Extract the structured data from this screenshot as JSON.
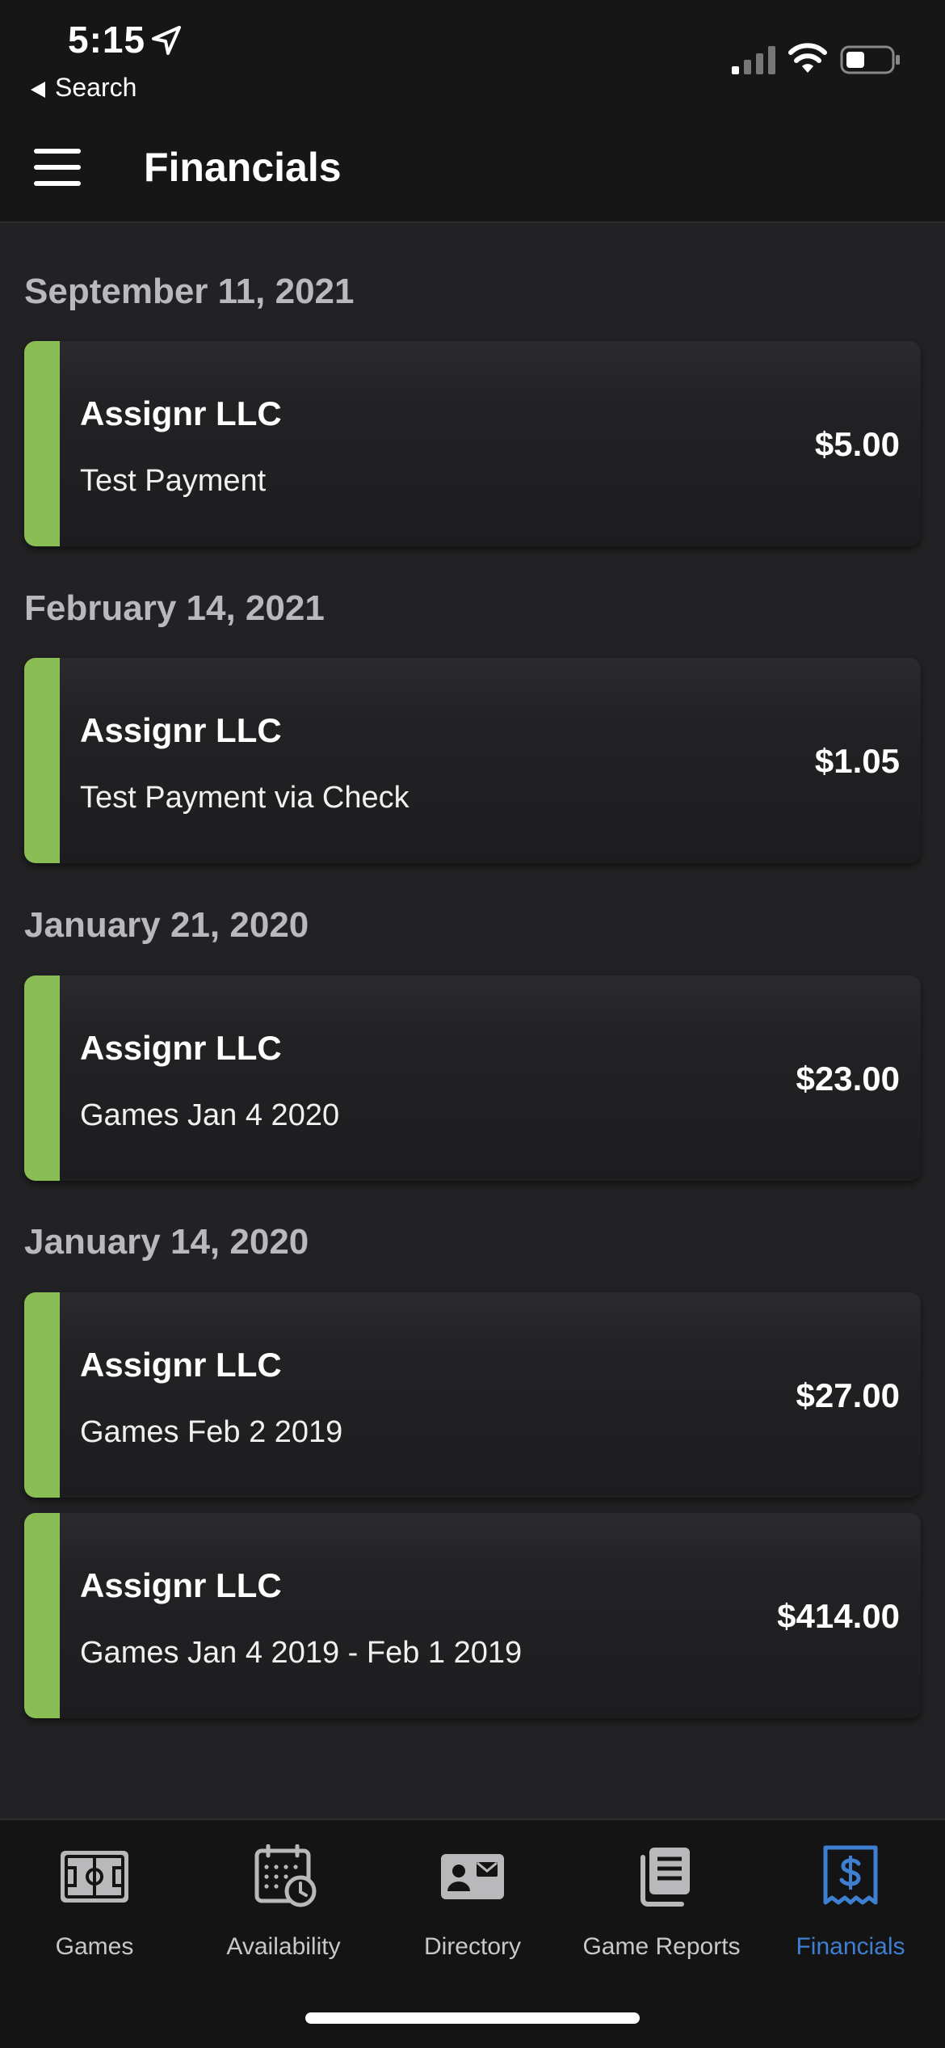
{
  "status": {
    "time": "5:15",
    "back_label": "Search"
  },
  "header": {
    "title": "Financials"
  },
  "groups": [
    {
      "date": "September 11, 2021",
      "items": [
        {
          "payer": "Assignr LLC",
          "description": "Test Payment",
          "amount": "$5.00"
        }
      ]
    },
    {
      "date": "February 14, 2021",
      "items": [
        {
          "payer": "Assignr LLC",
          "description": "Test Payment via Check",
          "amount": "$1.05"
        }
      ]
    },
    {
      "date": "January 21, 2020",
      "items": [
        {
          "payer": "Assignr LLC",
          "description": "Games Jan 4 2020",
          "amount": "$23.00"
        }
      ]
    },
    {
      "date": "January 14, 2020",
      "items": [
        {
          "payer": "Assignr LLC",
          "description": "Games Feb 2 2019",
          "amount": "$27.00"
        },
        {
          "payer": "Assignr LLC",
          "description": "Games Jan 4 2019 - Feb 1 2019",
          "amount": "$414.00"
        }
      ]
    }
  ],
  "tabs": [
    {
      "label": "Games",
      "icon": "field-icon"
    },
    {
      "label": "Availability",
      "icon": "calendar-clock-icon"
    },
    {
      "label": "Directory",
      "icon": "contact-card-icon"
    },
    {
      "label": "Game Reports",
      "icon": "reports-icon"
    },
    {
      "label": "Financials",
      "icon": "dollar-receipt-icon",
      "active": true
    }
  ],
  "colors": {
    "accent_stripe": "#8bbd55",
    "active_tab": "#3e7fd1",
    "background": "#222224"
  }
}
